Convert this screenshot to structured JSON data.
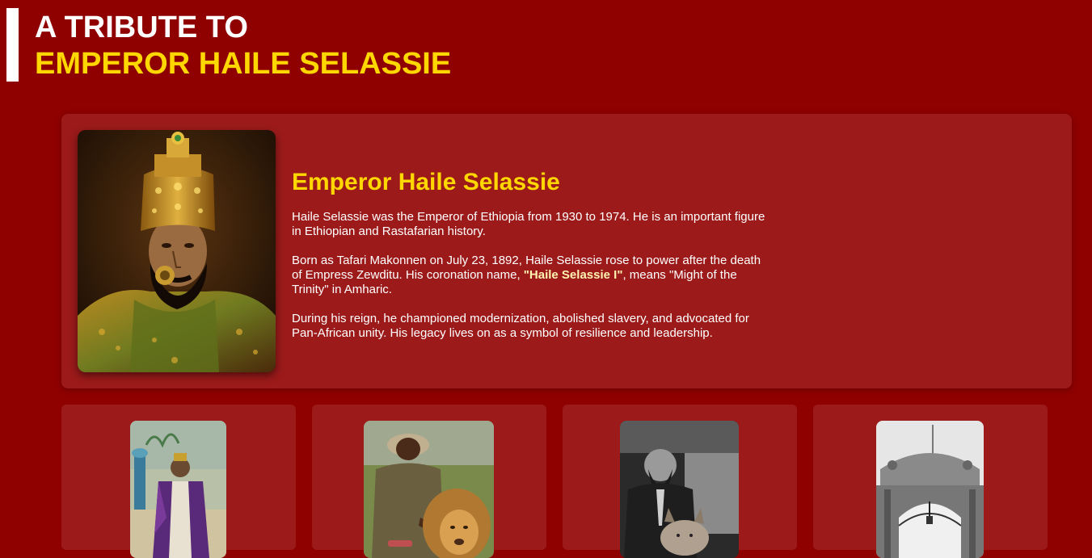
{
  "header": {
    "title_line1": "A TRIBUTE TO",
    "title_line2": "EMPEROR HAILE SELASSIE"
  },
  "hero": {
    "portrait_alt": "portrait-painting",
    "heading": "Emperor Haile Selassie",
    "paragraph1": "Haile Selassie was the Emperor of Ethiopia from 1930 to 1974. He is an important figure in Ethiopian and Rastafarian history.",
    "paragraph2_before": "Born as Tafari Makonnen on July 23, 1892, Haile Selassie rose to power after the death of Empress Zewditu. His coronation name, ",
    "paragraph2_bold": "\"Haile Selassie I\"",
    "paragraph2_after": ", means \"Might of the Trinity\" in Amharic.",
    "paragraph3": "During his reign, he championed modernization, abolished slavery, and advocated for Pan-African unity. His legacy lives on as a symbol of resilience and leadership."
  },
  "gallery": [
    {
      "image": "emperor-in-purple-robes-photo"
    },
    {
      "image": "man-feeding-lion-photo"
    },
    {
      "image": "emperor-with-dog-bw-photo"
    },
    {
      "image": "palace-gate-bw-photo"
    }
  ],
  "colors": {
    "background": "#8f0000",
    "card": "#9c1a1a",
    "accent": "#ffd700",
    "text": "#ffffff"
  }
}
